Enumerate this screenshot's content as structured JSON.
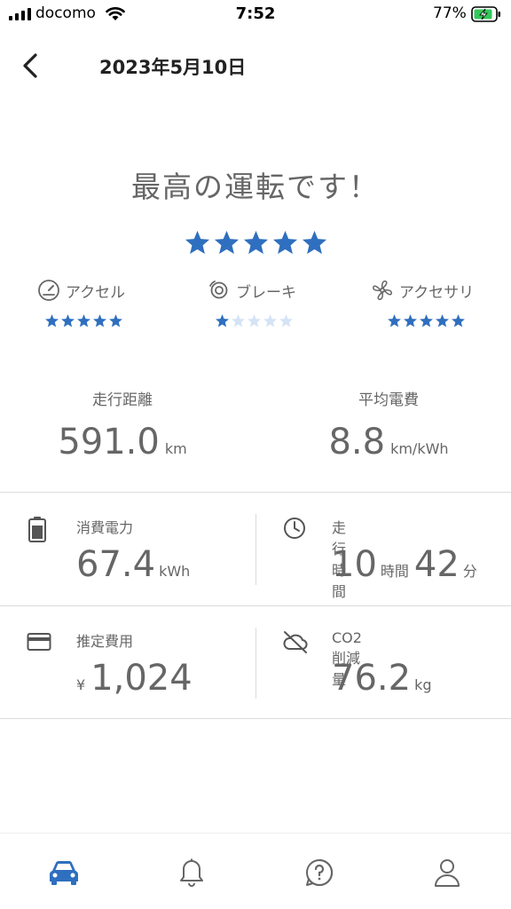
{
  "status_bar": {
    "carrier": "docomo",
    "time": "7:52",
    "battery": "77%"
  },
  "header": {
    "title": "2023年5月10日",
    "back_icon": "chevron-left-icon"
  },
  "rating": {
    "headline": "最高の運転です！",
    "overall_stars": 5,
    "max_stars": 5,
    "categories": [
      {
        "label": "アクセル",
        "icon": "speedometer-icon",
        "stars": 5
      },
      {
        "label": "ブレーキ",
        "icon": "brake-icon",
        "stars": 1
      },
      {
        "label": "アクセサリ",
        "icon": "fan-icon",
        "stars": 5
      }
    ]
  },
  "summary": {
    "distance": {
      "label": "走行距離",
      "value": "591.0",
      "unit": "km"
    },
    "efficiency": {
      "label": "平均電費",
      "value": "8.8",
      "unit": "km/kWh"
    }
  },
  "details": {
    "energy": {
      "label": "消費電力",
      "value": "67.4",
      "unit": "kWh",
      "icon": "battery-icon"
    },
    "time": {
      "label": "走行時間",
      "hours": "10",
      "hours_unit": "時間",
      "minutes": "42",
      "minutes_unit": "分",
      "icon": "clock-icon"
    },
    "cost": {
      "label": "推定費用",
      "currency": "¥",
      "value": "1,024",
      "icon": "credit-card-icon"
    },
    "co2": {
      "label": "CO2削減量",
      "value": "76.2",
      "unit": "kg",
      "icon": "cloud-off-icon"
    }
  },
  "tabbar": {
    "items": [
      {
        "icon": "car-icon",
        "active": true
      },
      {
        "icon": "bell-icon",
        "active": false
      },
      {
        "icon": "help-icon",
        "active": false
      },
      {
        "icon": "person-icon",
        "active": false
      }
    ]
  },
  "colors": {
    "accent": "#2f6fbf",
    "star_inactive": "#d4e4f5",
    "text": "#666666",
    "divider": "#dcdcdc"
  }
}
